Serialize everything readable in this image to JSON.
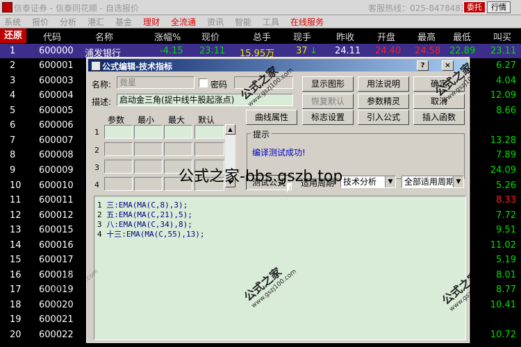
{
  "window": {
    "title": "信泰证券 - 信泰同花顺 - 自选报价",
    "hotline": "客服热线：025-84784836",
    "buttons": {
      "weituo": "委托",
      "hangqing": "行情"
    }
  },
  "menu": [
    {
      "label": "系统",
      "red": false
    },
    {
      "label": "报价",
      "red": false
    },
    {
      "label": "分析",
      "red": false
    },
    {
      "label": "港汇",
      "red": false
    },
    {
      "label": "基金",
      "red": false
    },
    {
      "label": "理财",
      "red": true
    },
    {
      "label": "全流通",
      "red": true
    },
    {
      "label": "资讯",
      "red": false
    },
    {
      "label": "智能",
      "red": false
    },
    {
      "label": "工具",
      "red": false
    },
    {
      "label": "在线服务",
      "red": true
    }
  ],
  "table": {
    "restore": "还原",
    "columns": [
      "代码",
      "名称",
      "涨幅%",
      "现价",
      "总手",
      "现手",
      "昨收",
      "开盘",
      "最高",
      "最低",
      "叫买"
    ],
    "rows": [
      {
        "num": "1",
        "code": "600000",
        "name": "浦发银行",
        "change": "-4.15",
        "price": "23.11",
        "volume": "15.95万",
        "hand": "37",
        "prev": "24.11",
        "open": "24.40",
        "high": "24.58",
        "low": "22.89",
        "bid": "23.11",
        "selected": true
      },
      {
        "num": "2",
        "code": "600001",
        "bid": "6.27",
        "red": false
      },
      {
        "num": "3",
        "code": "600003",
        "bid": "4.04",
        "red": false
      },
      {
        "num": "4",
        "code": "600004",
        "bid": "12.09",
        "red": false
      },
      {
        "num": "5",
        "code": "600005",
        "bid": "8.66",
        "red": false
      },
      {
        "num": "6",
        "code": "600006",
        "bid": "",
        "red": false
      },
      {
        "num": "7",
        "code": "600007",
        "bid": "13.28",
        "red": false
      },
      {
        "num": "8",
        "code": "600008",
        "bid": "7.89",
        "red": false
      },
      {
        "num": "9",
        "code": "600009",
        "bid": "24.09",
        "red": false
      },
      {
        "num": "10",
        "code": "600010",
        "bid": "5.26",
        "red": false
      },
      {
        "num": "11",
        "code": "600011",
        "bid": "8.33",
        "red": true
      },
      {
        "num": "12",
        "code": "600012",
        "bid": "7.72",
        "red": false
      },
      {
        "num": "13",
        "code": "600015",
        "bid": "9.51",
        "red": false
      },
      {
        "num": "14",
        "code": "600016",
        "bid": "11.02",
        "red": false
      },
      {
        "num": "15",
        "code": "600017",
        "bid": "5.19",
        "red": false
      },
      {
        "num": "16",
        "code": "600018",
        "bid": "8.01",
        "red": false
      },
      {
        "num": "17",
        "code": "600019",
        "bid": "8.77",
        "red": false
      },
      {
        "num": "18",
        "code": "600020",
        "bid": "10.41",
        "red": false
      },
      {
        "num": "19",
        "code": "600021",
        "bid": "",
        "red": false
      },
      {
        "num": "20",
        "code": "600022",
        "bid": "10.72",
        "red": false
      }
    ]
  },
  "dialog": {
    "title": "公式编辑-技术指标",
    "name_label": "名称:",
    "name_value": "竟星",
    "password_label": "密码",
    "desc_label": "描述:",
    "desc_value": "启动金三角(捉中线牛股起涨点)",
    "param_headers": [
      "参数",
      "最小",
      "最大",
      "默认"
    ],
    "param_rows": [
      "1",
      "2",
      "3",
      "4"
    ],
    "buttons": {
      "show_graph": "显示图形",
      "usage": "用法说明",
      "ok": "确定",
      "restore_default": "恢复默认",
      "param_wizard": "参数精灵",
      "cancel": "取消",
      "curve_props": "曲线属性",
      "sign_settings": "标志设置",
      "import_formula": "引入公式",
      "insert_function": "插入函数",
      "test_formula": "测试公式"
    },
    "hint_label": "提示",
    "hint_text": "编译测试成功!",
    "period_label": "适用周期",
    "type_select": "技术分析",
    "period_select": "全部适用周期",
    "code_lines": [
      {
        "ln": "1",
        "text": "三:EMA(MA(C,8),3);"
      },
      {
        "ln": "2",
        "text": "五:EMA(MA(C,21),5);"
      },
      {
        "ln": "3",
        "text": "八:EMA(MA(C,34),8);"
      },
      {
        "ln": "4",
        "text": "十三:EMA(MA(C,55),13);"
      }
    ]
  },
  "overlay_text": "公式之家-bbs.gszb.top",
  "watermarks": [
    {
      "text": "公式之家",
      "sub": "www.gszj100.com"
    },
    {
      "text": "公式之家",
      "sub": "www.gszj100.com"
    },
    {
      "text": "公式之家",
      "sub": "www.gszj100.com"
    },
    {
      "text": "公式之家",
      "sub": "www.gszj100.com"
    },
    {
      "text": "公式之家",
      "sub": "www.gszj100.com"
    }
  ]
}
